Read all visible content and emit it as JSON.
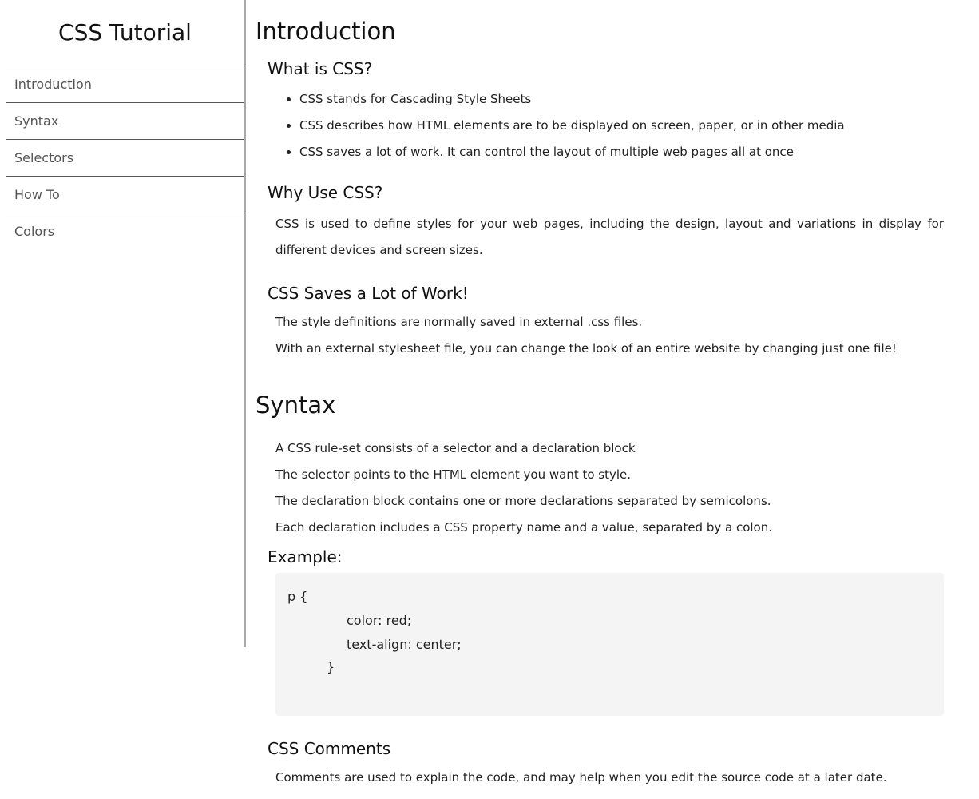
{
  "sidebar": {
    "title": "CSS Tutorial",
    "items": [
      {
        "label": "Introduction"
      },
      {
        "label": "Syntax"
      },
      {
        "label": "Selectors"
      },
      {
        "label": "How To"
      },
      {
        "label": "Colors"
      }
    ]
  },
  "introduction": {
    "heading": "Introduction",
    "what": {
      "heading": "What is CSS?",
      "bullets": [
        "CSS stands for Cascading Style Sheets",
        "CSS describes how HTML elements are to be displayed on screen, paper, or in other media",
        "CSS saves a lot of work. It can control the layout of multiple web pages all at once"
      ]
    },
    "why": {
      "heading": "Why Use CSS?",
      "text": "CSS is used to define styles for your web pages, including the design, layout and variations in display for different devices and screen sizes."
    },
    "saves": {
      "heading": "CSS Saves a Lot of Work!",
      "lines": [
        "The style definitions are normally saved in external .css files.",
        "With an external stylesheet file, you can change the look of an entire website by changing just one file!"
      ]
    }
  },
  "syntax": {
    "heading": "Syntax",
    "lines": [
      "A CSS rule-set consists of a selector and a declaration block",
      "The selector points to the HTML element you want to style.",
      "The declaration block contains one or more declarations separated by semicolons.",
      "Each declaration includes a CSS property name and a value, separated by a colon."
    ],
    "example": {
      "heading": "Example:",
      "code": {
        "open": "p {",
        "line1": "color: red;",
        "line2": "text-align: center;",
        "close": "}"
      }
    },
    "comments": {
      "heading": "CSS Comments",
      "text": "Comments are used to explain the code, and may help when you edit the source code at a later date."
    }
  }
}
